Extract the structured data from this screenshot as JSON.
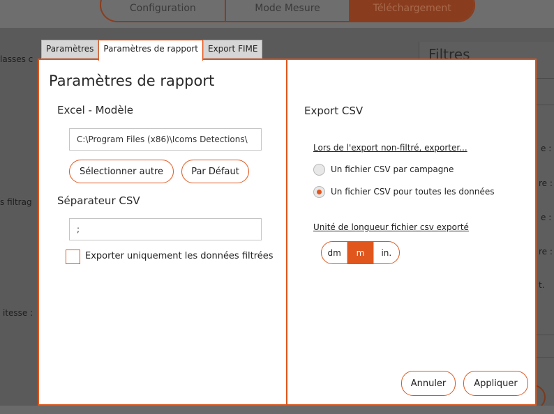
{
  "background": {
    "nav_tabs": [
      "Configuration",
      "Mode Mesure",
      "Téléchargement"
    ],
    "left_fragments": [
      "lasses c",
      "s filtrag",
      "itesse :"
    ],
    "right_panel_title": "Filtres",
    "right_fragments": [
      "e :",
      "re :",
      "e :",
      "re :",
      "t."
    ]
  },
  "tabs": [
    {
      "label": "Paramètres",
      "active": false
    },
    {
      "label": "Paramètres de rapport",
      "active": true
    },
    {
      "label": "Export FIME",
      "active": false
    }
  ],
  "left_panel": {
    "title": "Paramètres de rapport",
    "excel_label": "Excel - Modèle",
    "excel_path": "C:\\Program Files (x86)\\Icoms Detections\\",
    "select_other_label": "Sélectionner autre",
    "default_label": "Par Défaut",
    "separator_label": "Séparateur CSV",
    "separator_value": ";",
    "filtered_only_label": "Exporter uniquement les données filtrées",
    "filtered_only_checked": false
  },
  "right_panel": {
    "title": "Export CSV",
    "unfiltered_export_label": "Lors de l'export non-filtré, exporter...",
    "radio_options": [
      {
        "label": "Un fichier CSV par campagne",
        "checked": false
      },
      {
        "label": "Un fichier CSV pour toutes les données",
        "checked": true
      }
    ],
    "unit_label": "Unité de longueur fichier csv exporté",
    "units": [
      {
        "label": "dm",
        "active": false
      },
      {
        "label": "m",
        "active": true
      },
      {
        "label": "in.",
        "active": false
      }
    ],
    "cancel_label": "Annuler",
    "apply_label": "Appliquer"
  },
  "colors": {
    "accent": "#e0561c",
    "overlay_background": "#5a5a5a"
  }
}
